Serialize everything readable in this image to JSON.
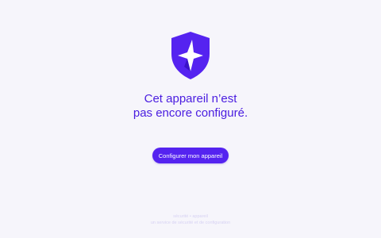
{
  "app": {
    "logo_icon": "shield-lightning-logo",
    "accent_color": "#5523f0"
  },
  "message": {
    "line1": "Cet appareil n’est",
    "line2": "pas encore configuré."
  },
  "actions": {
    "configure_label": "Configurer mon appareil"
  },
  "footer": {
    "line1": "sécurité • appareil",
    "line2": "un service de sécurité et de configuration"
  }
}
